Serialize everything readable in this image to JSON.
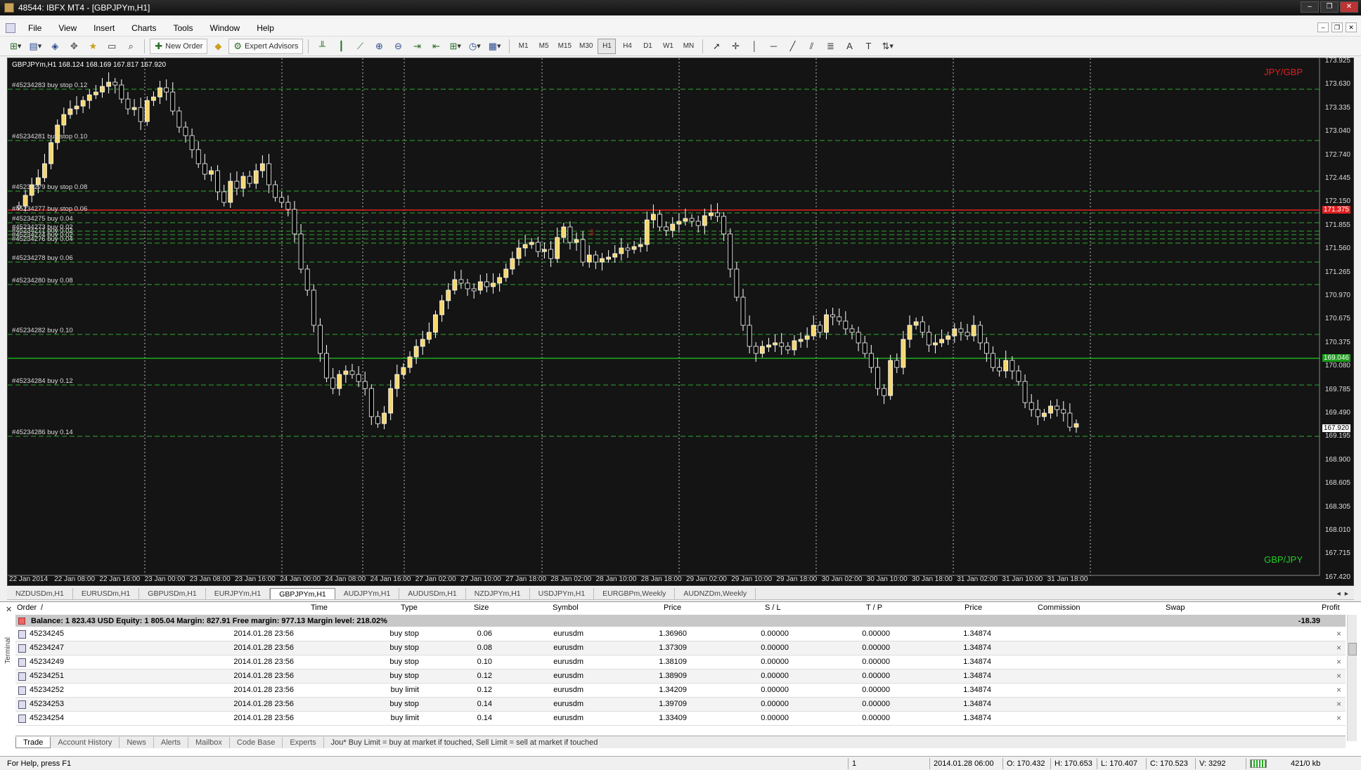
{
  "window": {
    "title": "48544: IBFX MT4 - [GBPJPYm,H1]"
  },
  "menu": [
    "File",
    "View",
    "Insert",
    "Charts",
    "Tools",
    "Window",
    "Help"
  ],
  "toolbar": {
    "new_order": "New Order",
    "expert_advisors": "Expert Advisors",
    "timeframes": [
      "M1",
      "M5",
      "M15",
      "M30",
      "H1",
      "H4",
      "D1",
      "W1",
      "MN"
    ],
    "selected_timeframe": "H1"
  },
  "chart": {
    "info": "GBPJPYm,H1  168.124 168.169 167.817 167.920",
    "pair_top": "JPY/GBP",
    "pair_bottom": "GBP/JPY",
    "price_levels": [
      "173.925",
      "173.630",
      "173.335",
      "173.040",
      "172.740",
      "172.445",
      "172.150",
      "171.855",
      "171.560",
      "171.265",
      "170.970",
      "170.675",
      "170.375",
      "170.080",
      "169.785",
      "169.490",
      "169.195",
      "168.900",
      "168.605",
      "168.305",
      "168.010",
      "167.715",
      "167.420"
    ],
    "bid_tag": "171.375",
    "current_tag": "167.920",
    "green_line_tag": "169.046",
    "time_labels": [
      "22 Jan 2014",
      "22 Jan 08:00",
      "22 Jan 16:00",
      "23 Jan 00:00",
      "23 Jan 08:00",
      "23 Jan 16:00",
      "24 Jan 00:00",
      "24 Jan 08:00",
      "24 Jan 16:00",
      "27 Jan 02:00",
      "27 Jan 10:00",
      "27 Jan 18:00",
      "28 Jan 02:00",
      "28 Jan 10:00",
      "28 Jan 18:00",
      "29 Jan 02:00",
      "29 Jan 10:00",
      "29 Jan 18:00",
      "30 Jan 02:00",
      "30 Jan 10:00",
      "30 Jan 18:00",
      "31 Jan 02:00",
      "31 Jan 10:00",
      "31 Jan 18:00"
    ],
    "order_lines": [
      {
        "label": "#45234283 buy stop 0.12"
      },
      {
        "label": "#45234281 buy stop 0.10"
      },
      {
        "label": "#45234279 buy stop 0.08"
      },
      {
        "label": "#45234277 buy stop 0.06"
      },
      {
        "label": "#45234275 buy 0.04"
      },
      {
        "label": "#45234273 buy 0.02"
      },
      {
        "label": "#45234271 buy 0.02"
      },
      {
        "label": "#45234274 buy 0.02"
      },
      {
        "label": "#45234276 buy 0.04"
      },
      {
        "label": "#45234278 buy 0.06"
      },
      {
        "label": "#45234280 buy 0.08"
      },
      {
        "label": "#45234282 buy 0.10"
      },
      {
        "label": "#45234284 buy 0.12"
      },
      {
        "label": "#45234286 buy 0.14"
      }
    ]
  },
  "chart_tabs": [
    "NZDUSDm,H1",
    "EURUSDm,H1",
    "GBPUSDm,H1",
    "EURJPYm,H1",
    "GBPJPYm,H1",
    "AUDJPYm,H1",
    "AUDUSDm,H1",
    "NZDJPYm,H1",
    "USDJPYm,H1",
    "EURGBPm,Weekly",
    "AUDNZDm,Weekly"
  ],
  "active_chart_tab": "GBPJPYm,H1",
  "terminal": {
    "columns": [
      "Order",
      "/",
      "Time",
      "Type",
      "Size",
      "Symbol",
      "Price",
      "S / L",
      "T / P",
      "Price",
      "Commission",
      "Swap",
      "Profit"
    ],
    "balance_line": "Balance: 1 823.43 USD  Equity: 1 805.04  Margin: 827.91  Free margin: 977.13  Margin level: 218.02%",
    "balance_profit": "-18.39",
    "rows": [
      {
        "order": "45234245",
        "time": "2014.01.28 23:56",
        "type": "buy stop",
        "size": "0.06",
        "symbol": "eurusdm",
        "price": "1.36960",
        "sl": "0.00000",
        "tp": "0.00000",
        "cur": "1.34874"
      },
      {
        "order": "45234247",
        "time": "2014.01.28 23:56",
        "type": "buy stop",
        "size": "0.08",
        "symbol": "eurusdm",
        "price": "1.37309",
        "sl": "0.00000",
        "tp": "0.00000",
        "cur": "1.34874"
      },
      {
        "order": "45234249",
        "time": "2014.01.28 23:56",
        "type": "buy stop",
        "size": "0.10",
        "symbol": "eurusdm",
        "price": "1.38109",
        "sl": "0.00000",
        "tp": "0.00000",
        "cur": "1.34874"
      },
      {
        "order": "45234251",
        "time": "2014.01.28 23:56",
        "type": "buy stop",
        "size": "0.12",
        "symbol": "eurusdm",
        "price": "1.38909",
        "sl": "0.00000",
        "tp": "0.00000",
        "cur": "1.34874"
      },
      {
        "order": "45234252",
        "time": "2014.01.28 23:56",
        "type": "buy limit",
        "size": "0.12",
        "symbol": "eurusdm",
        "price": "1.34209",
        "sl": "0.00000",
        "tp": "0.00000",
        "cur": "1.34874"
      },
      {
        "order": "45234253",
        "time": "2014.01.28 23:56",
        "type": "buy stop",
        "size": "0.14",
        "symbol": "eurusdm",
        "price": "1.39709",
        "sl": "0.00000",
        "tp": "0.00000",
        "cur": "1.34874"
      },
      {
        "order": "45234254",
        "time": "2014.01.28 23:56",
        "type": "buy limit",
        "size": "0.14",
        "symbol": "eurusdm",
        "price": "1.33409",
        "sl": "0.00000",
        "tp": "0.00000",
        "cur": "1.34874"
      }
    ],
    "tabs": [
      "Trade",
      "Account History",
      "News",
      "Alerts",
      "Mailbox",
      "Code Base",
      "Experts"
    ],
    "active_tab": "Trade",
    "note": "Jou* Buy Limit = buy at market if touched, Sell Limit = sell at market if touched",
    "side_label": "Terminal"
  },
  "status": {
    "help": "For Help, press F1",
    "profile": "1",
    "datetime": "2014.01.28 06:00",
    "open": "O: 170.432",
    "high": "H: 170.653",
    "low": "L: 170.407",
    "close": "C: 170.523",
    "volume": "V: 3292",
    "traffic": "421/0 kb"
  },
  "colors": {
    "chart_bg": "#141414",
    "candle_up": "#f5d76e",
    "candle_outline": "#ffffff",
    "order_line": "#2fa82f",
    "bid_line": "#e02020",
    "green_line": "#22cc22"
  }
}
